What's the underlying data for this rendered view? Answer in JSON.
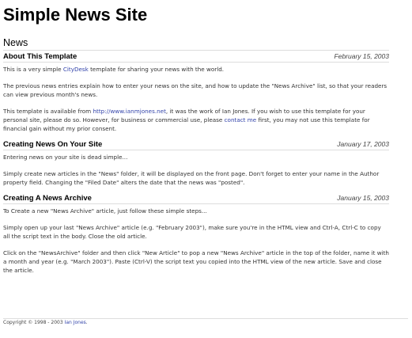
{
  "site": {
    "title": "Simple News Site"
  },
  "section": {
    "heading": "News"
  },
  "articles": [
    {
      "title": "About This Template",
      "date": "February 15, 2003",
      "p1_pre": "This is a very simple ",
      "p1_link": "CityDesk",
      "p1_post": " template for sharing your news with the world.",
      "p2": "The previous news entries explain how to enter your news on the site, and how to update the \"News Archive\" list, so that your readers can view previous month's news.",
      "p3_pre": "This template is available from ",
      "p3_link1": "http://www.ianmjones.net",
      "p3_mid": ", it was the work of Ian Jones. If you wish to use this template for your personal site, please do so. However, for business or commercial use, please ",
      "p3_link2": "contact me",
      "p3_post": " first, you may not use this template for financial gain without my prior consent."
    },
    {
      "title": "Creating News On Your Site",
      "date": "January 17, 2003",
      "p1": "Entering news on your site is dead simple...",
      "p2": "Simply create new articles in the \"News\" folder, it will be displayed on the front page. Don't forget to enter your name in the Author property field. Changing the \"Filed Date\" alters the date that the news was \"posted\"."
    },
    {
      "title": "Creating A News Archive",
      "date": "January 15, 2003",
      "p1": "To Create a new \"News Archive\" article, just follow these simple steps...",
      "p2": "Simply open up your last \"News Archive\" article (e.g. \"February 2003\"), make sure you're in the HTML view and Ctrl-A, Ctrl-C to copy all the script text in the body. Close the old article.",
      "p3": "Click on the \"NewsArchive\" folder and then click \"New Article\" to pop a new \"News Archive\" article in the top of the folder, name it with a month and year (e.g. \"March 2003\"). Paste (Ctrl-V) the script text you copied into the HTML view of the new article. Save and close the article."
    }
  ],
  "footer": {
    "text": "Copyright © 1998 - 2003 ",
    "link": "Ian Jones",
    "end": "."
  }
}
